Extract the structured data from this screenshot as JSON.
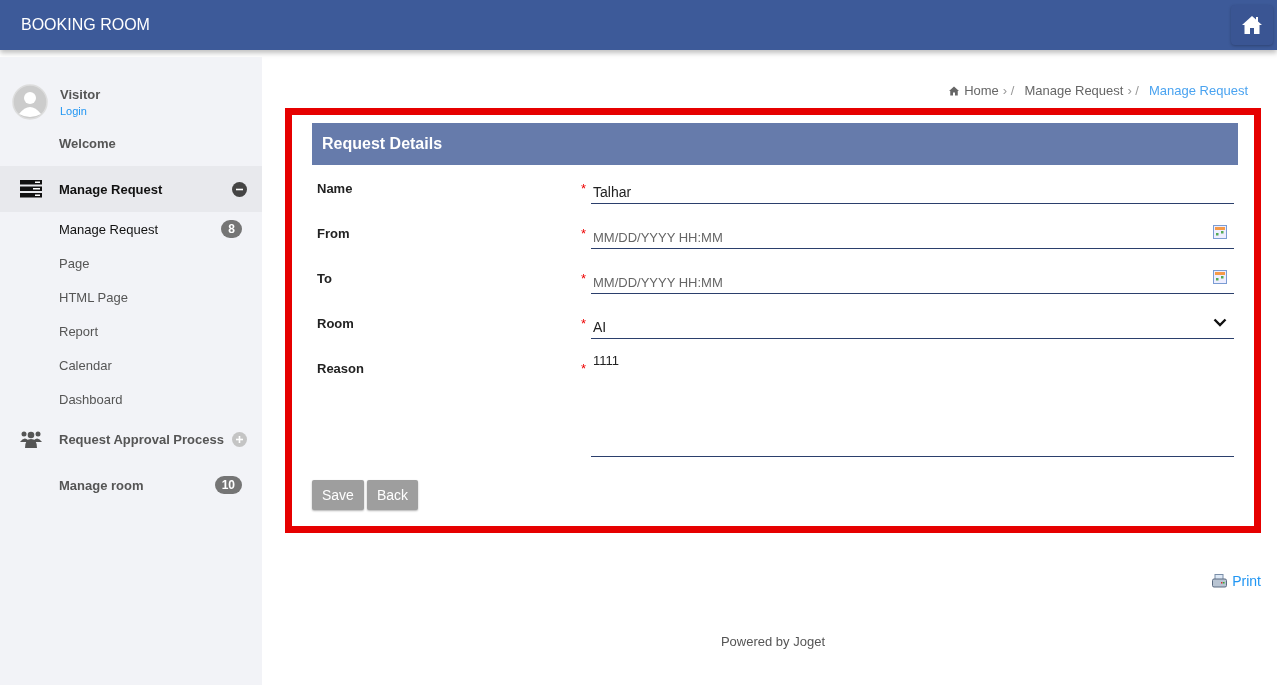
{
  "header": {
    "title": "BOOKING ROOM"
  },
  "user": {
    "name": "Visitor",
    "login": "Login"
  },
  "sidebar": {
    "items": [
      {
        "kind": "link",
        "label": "Welcome"
      },
      {
        "kind": "group",
        "label": "Manage Request",
        "expanded": true,
        "children": [
          {
            "label": "Manage Request",
            "badge": "8",
            "selected": true
          },
          {
            "label": "Page",
            "selected": false
          },
          {
            "label": "HTML Page",
            "selected": false
          },
          {
            "label": "Report",
            "selected": false
          },
          {
            "label": "Calendar",
            "selected": false
          },
          {
            "label": "Dashboard",
            "selected": false
          }
        ]
      },
      {
        "kind": "group",
        "label": "Request Approval Process",
        "expanded": false
      },
      {
        "kind": "link",
        "label": "Manage room",
        "badge": "10"
      }
    ]
  },
  "breadcrumb": [
    {
      "label": "Home",
      "separator": "› /"
    },
    {
      "label": "Manage Request",
      "separator": "› /"
    },
    {
      "label": "Manage Request"
    }
  ],
  "form": {
    "title": "Request Details",
    "required_mark": "*",
    "fields": [
      {
        "kind": "text",
        "label": "Name",
        "required": true,
        "value": "Talhar"
      },
      {
        "kind": "datetime",
        "label": "From",
        "required": true,
        "placeholder": "MM/DD/YYYY HH:MM"
      },
      {
        "kind": "datetime",
        "label": "To",
        "required": true,
        "placeholder": "MM/DD/YYYY HH:MM"
      },
      {
        "kind": "select",
        "label": "Room",
        "required": true,
        "value": "AI"
      },
      {
        "kind": "textarea",
        "label": "Reason",
        "required": true,
        "value": "1111"
      }
    ],
    "buttons": [
      "Save",
      "Back"
    ]
  },
  "print": "Print",
  "footer": "Powered by Joget"
}
